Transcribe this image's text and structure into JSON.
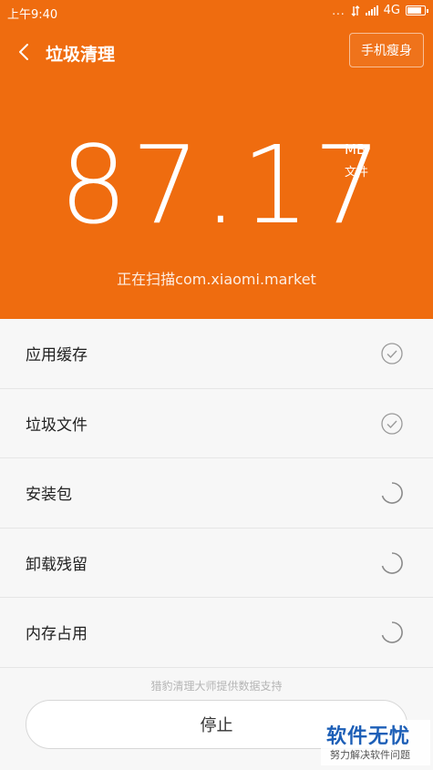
{
  "status_bar": {
    "time": "上午9:40",
    "dots": "...",
    "network": "4G"
  },
  "header": {
    "title": "垃圾清理",
    "slim_button": "手机瘦身",
    "size_value": "87.17",
    "size_unit": "MB",
    "size_kind": "文件",
    "scanning_text": "正在扫描com.xiaomi.market",
    "accent_color": "#ef6c0f"
  },
  "items": [
    {
      "label": "应用缓存",
      "state": "done"
    },
    {
      "label": "垃圾文件",
      "state": "done"
    },
    {
      "label": "安装包",
      "state": "scanning"
    },
    {
      "label": "卸载残留",
      "state": "scanning"
    },
    {
      "label": "内存占用",
      "state": "scanning"
    }
  ],
  "footer": {
    "note": "猎豹清理大师提供数据支持",
    "stop_button": "停止"
  },
  "watermark": {
    "main": "软件无忧",
    "sub": "努力解决软件问题"
  }
}
